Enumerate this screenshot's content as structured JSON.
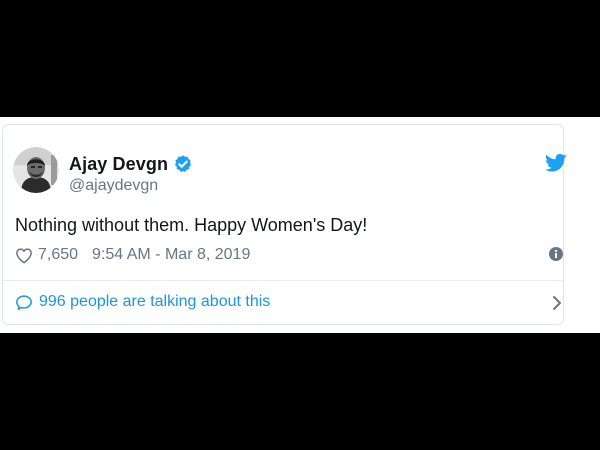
{
  "tweet": {
    "author": {
      "name": "Ajay Devgn",
      "handle": "@ajaydevgn",
      "verified": true
    },
    "text": "Nothing without them. Happy Women's Day!",
    "likes": "7,650",
    "timestamp": "9:54 AM - Mar 8, 2019",
    "conversation": "996 people are talking about this"
  },
  "icons": {
    "brand": "twitter-bird-icon",
    "verified": "verified-badge-icon",
    "like": "heart-icon",
    "info": "info-icon",
    "reply": "speech-bubble-icon",
    "more": "chevron-right-icon"
  },
  "colors": {
    "brand": "#1da1f2",
    "link": "#1b95e0",
    "text": "#14171a",
    "secondary": "#657786",
    "border": "#dfe5ea"
  }
}
